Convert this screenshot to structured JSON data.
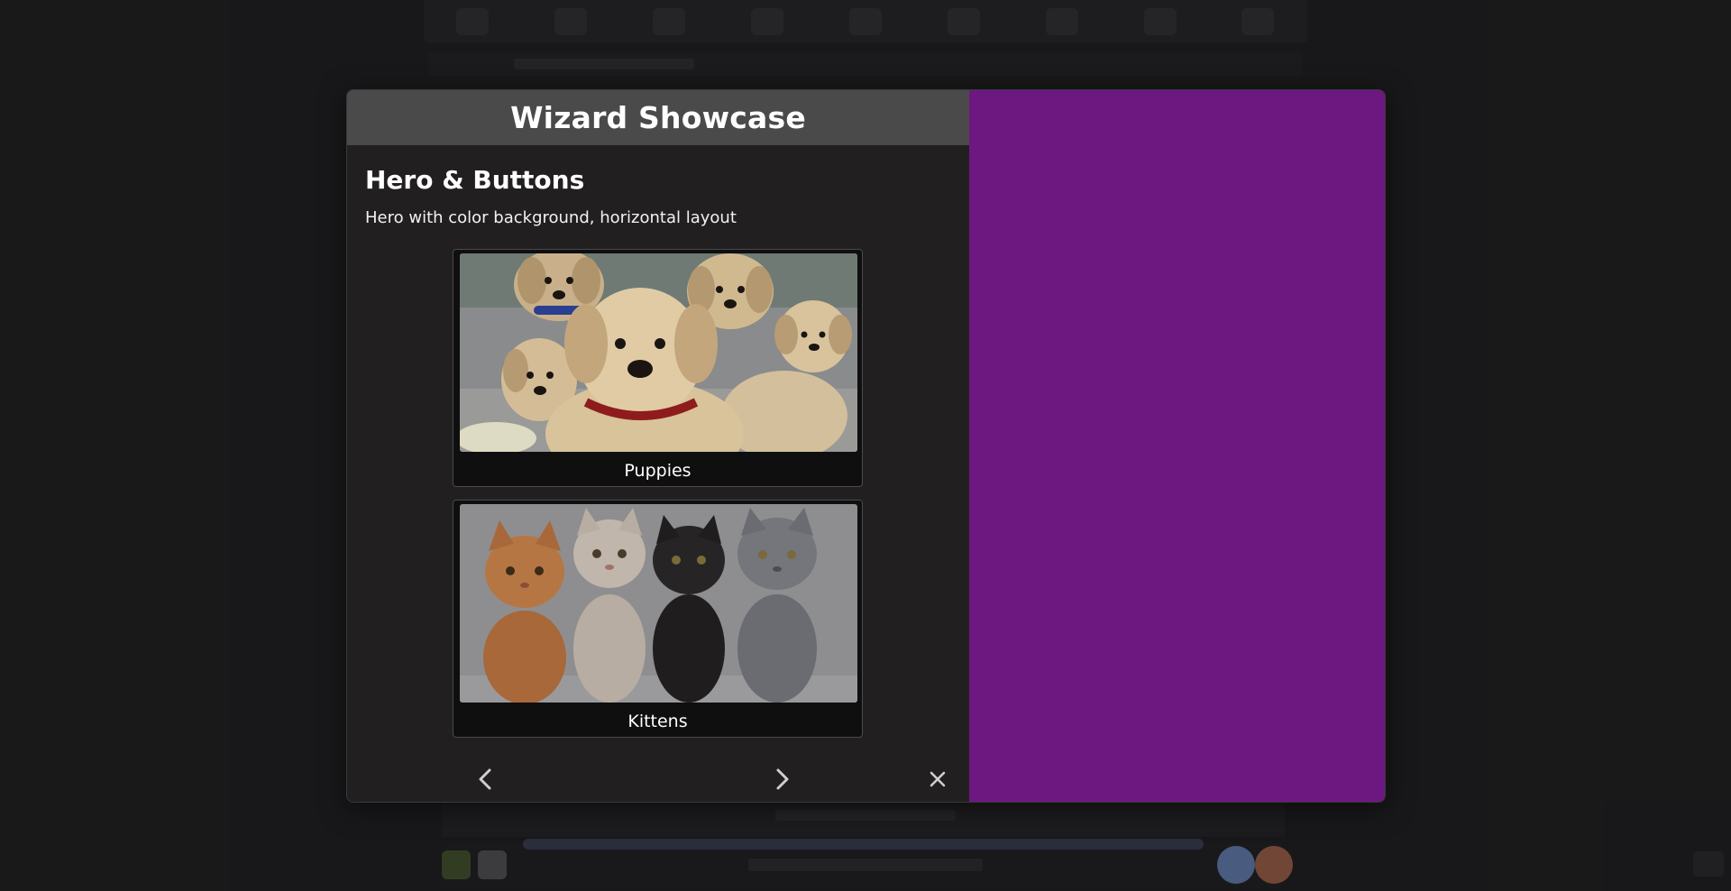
{
  "modal": {
    "title": "Wizard Showcase",
    "accent_color": "#6d1880",
    "header_color": "#4a4a4a"
  },
  "section": {
    "heading": "Hero & Buttons",
    "subtitle": "Hero with color background, horizontal layout"
  },
  "cards": [
    {
      "label": "Puppies",
      "icon": "puppies-image"
    },
    {
      "label": "Kittens",
      "icon": "kittens-image"
    }
  ],
  "nav": {
    "prev_icon": "chevron-left-icon",
    "next_icon": "chevron-right-icon",
    "close_icon": "close-icon"
  }
}
